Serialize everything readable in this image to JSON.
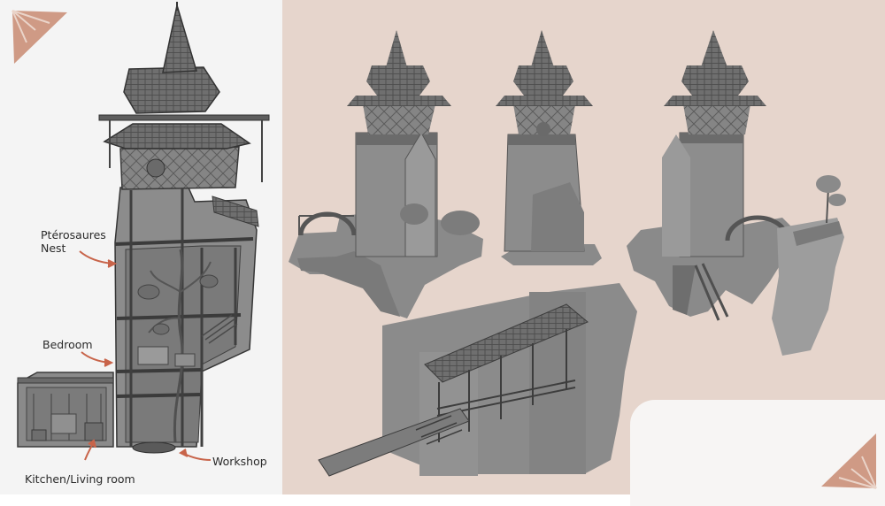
{
  "colors": {
    "left_background": "#f4f4f4",
    "right_background": "#e6d5cc",
    "sketch_gray": "#8c8c8c",
    "sketch_dark": "#4a4a4a",
    "arrow": "#c8644a",
    "logo": "#cf9a85"
  },
  "annotations": {
    "pterosaur_nest_line1": "Ptérosaures",
    "pterosaur_nest_line2": "Nest",
    "bedroom": "Bedroom",
    "kitchen": "Kitchen/Living room",
    "workshop": "Workshop"
  },
  "icons": {
    "top_left_logo": "wing-fan-icon",
    "bottom_right_logo": "wing-fan-icon"
  }
}
